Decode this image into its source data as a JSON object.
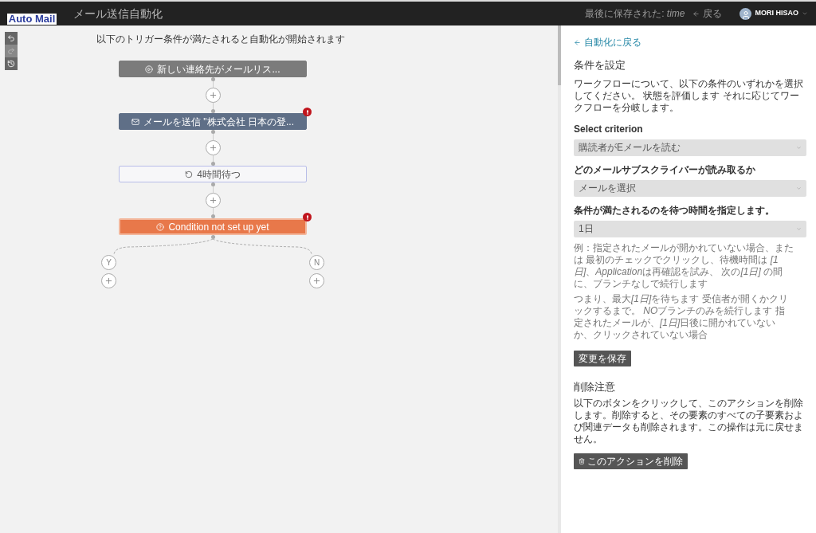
{
  "header": {
    "logo": "Auto Mail",
    "title": "メール送信自動化",
    "saved": "最後に保存された: ",
    "saved_time": "time",
    "back": "戻る",
    "user": "MORI HISAO"
  },
  "canvas": {
    "heading": "以下のトリガー条件が満たされると自動化が開始されます",
    "nodes": [
      {
        "kind": "trigger",
        "label": "新しい連絡先がメールリス...",
        "error": false
      },
      {
        "kind": "email",
        "label": "メールを送信 \"株式会社 日本の登...",
        "error": true
      },
      {
        "kind": "wait",
        "label": "4時間待つ",
        "error": false
      },
      {
        "kind": "condition",
        "label": "Condition not set up yet",
        "error": true
      }
    ],
    "branches": [
      "Y",
      "N"
    ]
  },
  "panel": {
    "back_link": "自動化に戻る",
    "title": "条件を設定",
    "description": "ワークフローについて、以下の条件のいずれかを選択してください。 状態を評価します それに応じてワークフローを分岐します。",
    "fields": [
      {
        "label": "Select criterion",
        "value": "購読者がEメールを読む"
      },
      {
        "label": "どのメールサブスクライバーが読み取るか",
        "value": "メールを選択"
      },
      {
        "label": "条件が満たされるのを待つ時間を指定します。",
        "value": "1日"
      }
    ],
    "notes": [
      [
        {
          "text": "例：指定されたメールが開かれていない場合、または 最初のチェックでクリックし、待機時間は ",
          "italic": false
        },
        {
          "text": "[1日]",
          "italic": true
        },
        {
          "text": "、",
          "italic": false
        },
        {
          "text": "Application",
          "italic": true
        },
        {
          "text": "は再確認を試み、 次の",
          "italic": false
        },
        {
          "text": "[1日]",
          "italic": true
        },
        {
          "text": " の間に、ブランチなしで続行します",
          "italic": false
        }
      ],
      [
        {
          "text": "つまり、最大",
          "italic": false
        },
        {
          "text": "[1日]",
          "italic": true
        },
        {
          "text": "を待ちます 受信者が開くかクリックするまで。 ",
          "italic": false
        },
        {
          "text": "NO",
          "italic": true
        },
        {
          "text": "ブランチのみを続行します 指定されたメールが、",
          "italic": false
        },
        {
          "text": "[1日]",
          "italic": true
        },
        {
          "text": "日後に開かれていないか、クリックされていない場合",
          "italic": false
        }
      ]
    ],
    "save_button": "変更を保存",
    "delete_title": "削除注意",
    "delete_text": "以下のボタンをクリックして、このアクションを削除します。削除すると、その要素のすべての子要素および関連データも削除されます。この操作は元に戻せません。",
    "delete_button": "このアクションを削除"
  }
}
